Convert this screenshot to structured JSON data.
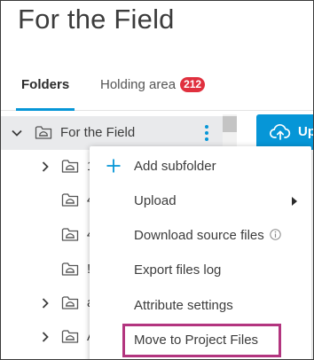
{
  "header": {
    "title": "For the Field"
  },
  "tabs": [
    {
      "label": "Folders",
      "active": true
    },
    {
      "label": "Holding area",
      "badge": "212"
    }
  ],
  "tree": {
    "root": {
      "label": "For the Field"
    },
    "children": [
      {
        "label": "1",
        "has_children": true
      },
      {
        "label": "4",
        "has_children": false
      },
      {
        "label": "4",
        "has_children": false
      },
      {
        "label": "!",
        "has_children": false
      },
      {
        "label": "a",
        "has_children": true
      },
      {
        "label": "A",
        "has_children": true
      }
    ]
  },
  "toolbar": {
    "upload_label": "Up",
    "upload_icon": "cloud-upload-icon"
  },
  "context_menu": {
    "items": [
      {
        "label": "Add subfolder",
        "icon": "plus-icon"
      },
      {
        "label": "Upload",
        "submenu": true
      },
      {
        "label": "Download source files",
        "icon": "info-icon"
      },
      {
        "label": "Export files log"
      },
      {
        "label": "Attribute settings"
      },
      {
        "label": "Move to Project Files",
        "highlighted": true
      }
    ]
  },
  "colors": {
    "accent": "#0696d7",
    "badge": "#e0303e",
    "highlight_border": "#b3357f",
    "selected_row": "#e9eaec"
  }
}
